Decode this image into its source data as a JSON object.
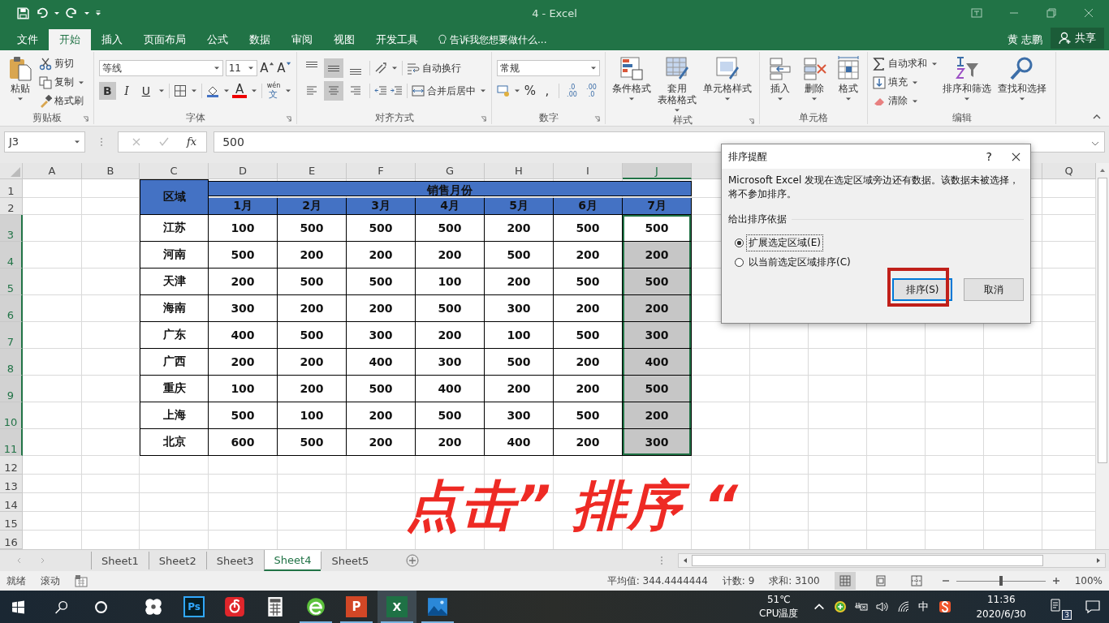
{
  "window": {
    "title": "4 - Excel"
  },
  "tabs": [
    {
      "label": "文件",
      "selected": false
    },
    {
      "label": "开始",
      "selected": true
    },
    {
      "label": "插入",
      "selected": false
    },
    {
      "label": "页面布局",
      "selected": false
    },
    {
      "label": "公式",
      "selected": false
    },
    {
      "label": "数据",
      "selected": false
    },
    {
      "label": "审阅",
      "selected": false
    },
    {
      "label": "视图",
      "selected": false
    },
    {
      "label": "开发工具",
      "selected": false
    }
  ],
  "tell_me": "告诉我您想要做什么...",
  "user": "黄 志鹏",
  "share": "共享",
  "ribbon": {
    "clipboard": {
      "label": "剪贴板",
      "paste": "粘贴",
      "cut": "剪切",
      "copy": "复制",
      "format_painter": "格式刷"
    },
    "font": {
      "label": "字体",
      "font_name": "等线",
      "font_size": "11",
      "grow": "A",
      "shrink": "A",
      "bold": "B",
      "italic": "I",
      "underline": "U",
      "font_color": "A",
      "phonetic_top": "wén",
      "phonetic_bottom": "文"
    },
    "alignment": {
      "label": "对齐方式",
      "vertical": [
        {
          "kind": "top",
          "selected": false
        },
        {
          "kind": "middle",
          "selected": true
        },
        {
          "kind": "bottom",
          "selected": false
        }
      ],
      "horizontal": [
        {
          "kind": "left",
          "selected": false
        },
        {
          "kind": "center",
          "selected": true
        },
        {
          "kind": "right",
          "selected": false
        }
      ],
      "wrap_text": "自动换行",
      "merge_center": "合并后居中"
    },
    "number": {
      "label": "数字",
      "format": "常规",
      "percent": "%",
      "comma": ",",
      "decimals": [
        {
          "top": ".0",
          "bottom": ".00"
        },
        {
          "top": ".00",
          "bottom": ".0"
        }
      ]
    },
    "styles": {
      "label": "样式",
      "buttons": [
        {
          "kind": "conditional",
          "lines": [
            "条件格式"
          ]
        },
        {
          "kind": "table",
          "lines": [
            "套用",
            "表格格式"
          ]
        },
        {
          "kind": "cell",
          "lines": [
            "单元格样式"
          ]
        }
      ]
    },
    "cells": {
      "label": "单元格",
      "buttons": [
        {
          "kind": "insert",
          "label": "插入"
        },
        {
          "kind": "delete",
          "label": "删除"
        },
        {
          "kind": "format",
          "label": "格式"
        }
      ]
    },
    "editing": {
      "label": "编辑",
      "autosum": "自动求和",
      "fill": "填充",
      "clear": "清除",
      "sort_filter": "排序和筛选",
      "find_select": "查找和选择"
    }
  },
  "formula_bar": {
    "name_box": "J3",
    "fx": "fx",
    "value": "500"
  },
  "sheet": {
    "columns": [
      {
        "label": "A",
        "selected": false
      },
      {
        "label": "B",
        "selected": false
      },
      {
        "label": "C",
        "selected": false
      },
      {
        "label": "D",
        "selected": false
      },
      {
        "label": "E",
        "selected": false
      },
      {
        "label": "F",
        "selected": false
      },
      {
        "label": "G",
        "selected": false
      },
      {
        "label": "H",
        "selected": false
      },
      {
        "label": "I",
        "selected": false
      },
      {
        "label": "J",
        "selected": true
      }
    ],
    "column_right": "Q",
    "rows": [
      {
        "label": "1",
        "selected": false
      },
      {
        "label": "2",
        "selected": false
      },
      {
        "label": "3",
        "selected": true
      },
      {
        "label": "4",
        "selected": true
      },
      {
        "label": "5",
        "selected": true
      },
      {
        "label": "6",
        "selected": true
      },
      {
        "label": "7",
        "selected": true
      },
      {
        "label": "8",
        "selected": true
      },
      {
        "label": "9",
        "selected": true
      },
      {
        "label": "10",
        "selected": true
      },
      {
        "label": "11",
        "selected": true
      },
      {
        "label": "12",
        "selected": false
      },
      {
        "label": "13",
        "selected": false
      },
      {
        "label": "14",
        "selected": false
      },
      {
        "label": "15",
        "selected": false
      },
      {
        "label": "16",
        "selected": false
      }
    ],
    "table": {
      "region_header": "区域",
      "group_header": "销售月份",
      "months": [
        "1月",
        "2月",
        "3月",
        "4月",
        "5月",
        "6月",
        "7月"
      ],
      "rows": [
        {
          "region": "江苏",
          "values": [
            "100",
            "500",
            "500",
            "500",
            "200",
            "500",
            "500"
          ],
          "active": true
        },
        {
          "region": "河南",
          "values": [
            "500",
            "200",
            "200",
            "200",
            "500",
            "200",
            "200"
          ],
          "active": false
        },
        {
          "region": "天津",
          "values": [
            "200",
            "500",
            "500",
            "100",
            "200",
            "500",
            "500"
          ],
          "active": false
        },
        {
          "region": "海南",
          "values": [
            "300",
            "200",
            "200",
            "500",
            "300",
            "200",
            "200"
          ],
          "active": false
        },
        {
          "region": "广东",
          "values": [
            "400",
            "500",
            "300",
            "200",
            "100",
            "500",
            "300"
          ],
          "active": false
        },
        {
          "region": "广西",
          "values": [
            "200",
            "200",
            "400",
            "300",
            "500",
            "200",
            "400"
          ],
          "active": false
        },
        {
          "region": "重庆",
          "values": [
            "100",
            "200",
            "500",
            "400",
            "200",
            "200",
            "500"
          ],
          "active": false
        },
        {
          "region": "上海",
          "values": [
            "500",
            "100",
            "200",
            "500",
            "300",
            "500",
            "200"
          ],
          "active": false
        },
        {
          "region": "北京",
          "values": [
            "600",
            "500",
            "200",
            "200",
            "400",
            "200",
            "300"
          ],
          "active": false
        }
      ]
    }
  },
  "dialog": {
    "title": "排序提醒",
    "help": "?",
    "message": "Microsoft Excel 发现在选定区域旁边还有数据。该数据未被选择，将不参加排序。",
    "group_label": "给出排序依据",
    "options": [
      {
        "label": "扩展选定区域(E)",
        "selected": true
      },
      {
        "label": "以当前选定区域排序(C)",
        "selected": false
      }
    ],
    "buttons": [
      {
        "label": "排序(S)",
        "default": true,
        "highlighted": true
      },
      {
        "label": "取消",
        "default": false,
        "highlighted": false
      }
    ]
  },
  "annotation": "点击” 排序 “",
  "sheet_tabs": [
    {
      "label": "Sheet1",
      "selected": false
    },
    {
      "label": "Sheet2",
      "selected": false
    },
    {
      "label": "Sheet3",
      "selected": false
    },
    {
      "label": "Sheet4",
      "selected": true
    },
    {
      "label": "Sheet5",
      "selected": false
    }
  ],
  "status_bar": {
    "ready": "就绪",
    "scroll": "滚动",
    "average": "平均值: 344.4444444",
    "count": "计数: 9",
    "sum": "求和: 3100",
    "views": [
      {
        "kind": "normal",
        "selected": true
      },
      {
        "kind": "page_layout",
        "selected": false
      },
      {
        "kind": "page_break",
        "selected": false
      }
    ],
    "zoom": {
      "level": 0.5,
      "reading": "100%"
    }
  },
  "taskbar": {
    "apps": [
      {
        "kind": "fan",
        "running": false,
        "selected": false
      },
      {
        "kind": "photoshop",
        "glyph": "Ps",
        "running": false,
        "selected": false
      },
      {
        "kind": "music",
        "running": false,
        "selected": false
      },
      {
        "kind": "calculator",
        "running": false,
        "selected": false
      },
      {
        "kind": "browser",
        "running": true,
        "selected": false
      },
      {
        "kind": "powerpoint",
        "glyph": "P",
        "running": true,
        "selected": false
      },
      {
        "kind": "excel",
        "glyph": "X",
        "running": true,
        "selected": true
      },
      {
        "kind": "photos",
        "running": true,
        "selected": false
      }
    ],
    "temperature": "51℃",
    "temperature_label": "CPU温度",
    "ime": "中",
    "time": "11:36",
    "date": "2020/6/30",
    "notifications": "3"
  }
}
